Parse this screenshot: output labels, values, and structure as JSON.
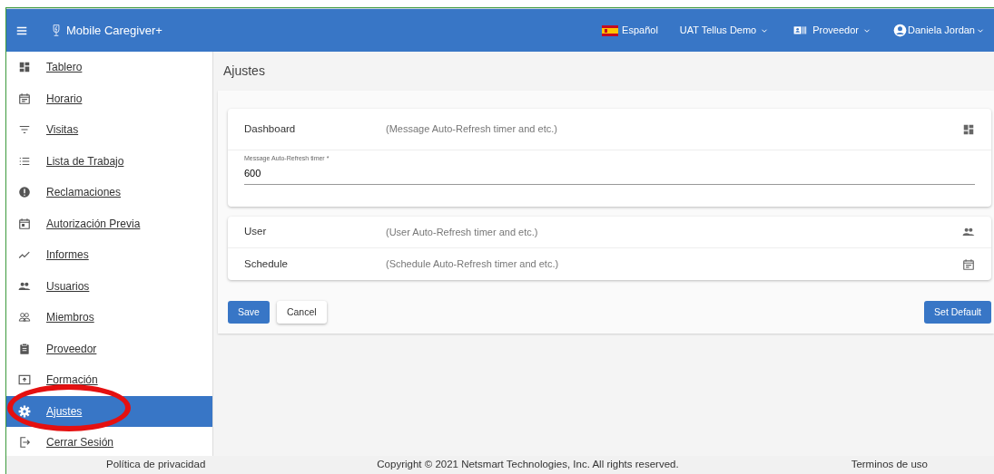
{
  "navbar": {
    "app_name": "Mobile Caregiver+",
    "language": "Español",
    "organization": "UAT Tellus Demo",
    "role": "Proveedor",
    "user": "Daniela Jordan"
  },
  "sidebar": {
    "items": [
      {
        "label": "Tablero",
        "selected": false
      },
      {
        "label": "Horario",
        "selected": false
      },
      {
        "label": "Visitas",
        "selected": false
      },
      {
        "label": "Lista de Trabajo",
        "selected": false
      },
      {
        "label": "Reclamaciones",
        "selected": false
      },
      {
        "label": "Autorización Previa",
        "selected": false
      },
      {
        "label": "Informes",
        "selected": false
      },
      {
        "label": "Usuarios",
        "selected": false
      },
      {
        "label": "Miembros",
        "selected": false
      },
      {
        "label": "Proveedor",
        "selected": false
      },
      {
        "label": "Formación",
        "selected": false
      },
      {
        "label": "Ajustes",
        "selected": true
      },
      {
        "label": "Cerrar Sesión",
        "selected": false
      }
    ]
  },
  "page_title": "Ajustes",
  "panels": [
    {
      "sections": [
        {
          "title": "Dashboard",
          "description": "(Message Auto-Refresh timer and etc.)",
          "field": {
            "label": "Message Auto-Refresh timer *",
            "value": "600"
          }
        }
      ]
    },
    {
      "sections": [
        {
          "title": "User",
          "description": "(User Auto-Refresh timer and etc.)"
        },
        {
          "title": "Schedule",
          "description": "(Schedule Auto-Refresh timer and etc.)"
        }
      ]
    }
  ],
  "buttons": {
    "save": "Save",
    "cancel": "Cancel",
    "set_default": "Set Default"
  },
  "footer": {
    "privacy": "Política de privacidad",
    "copyright": "Copyright © 2021 Netsmart Technologies, Inc. All rights reserved.",
    "terms": "Terminos de uso"
  }
}
